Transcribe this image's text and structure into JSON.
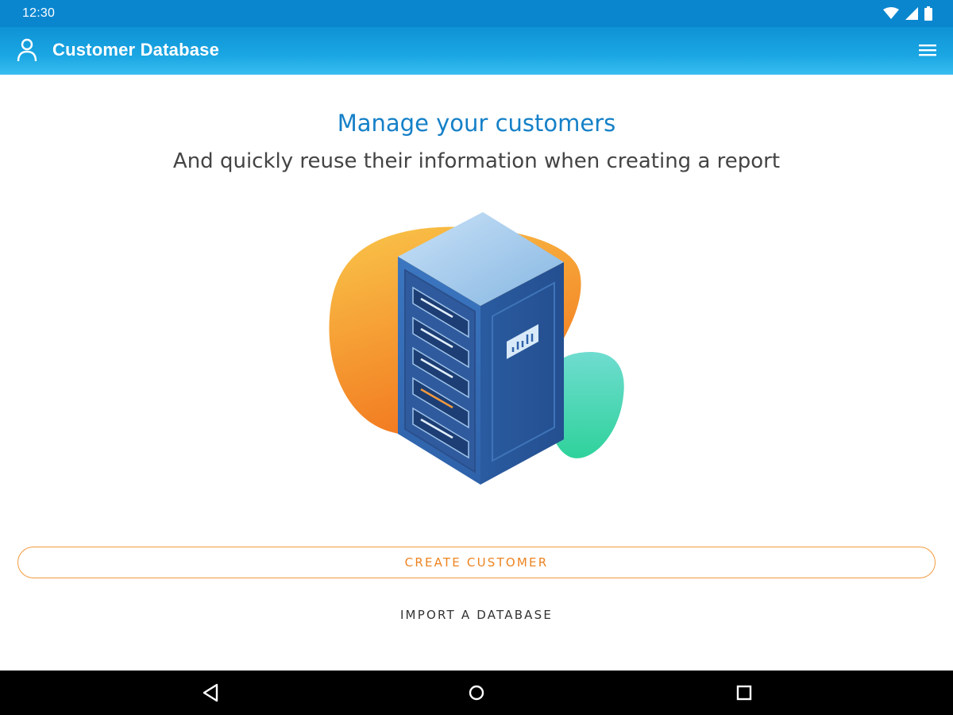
{
  "status_bar": {
    "time": "12:30",
    "icons": [
      "wifi-icon",
      "signal-icon",
      "battery-icon"
    ]
  },
  "app_bar": {
    "title": "Customer Database",
    "left_icon": "user-icon",
    "right_icon": "menu-icon"
  },
  "main": {
    "headline": "Manage your customers",
    "subheadline": "And quickly reuse their information when creating a report",
    "illustration": "server-rack-illustration"
  },
  "actions": {
    "create_label": "CREATE CUSTOMER",
    "import_label": "IMPORT A DATABASE"
  },
  "nav_bar": {
    "buttons": [
      "back-icon",
      "home-icon",
      "recents-icon"
    ]
  },
  "colors": {
    "status_bar": "#0a86cf",
    "app_bar": "#1aa6e3",
    "headline": "#1580c8",
    "accent_orange": "#ee8420",
    "nav_bar": "#000000"
  }
}
